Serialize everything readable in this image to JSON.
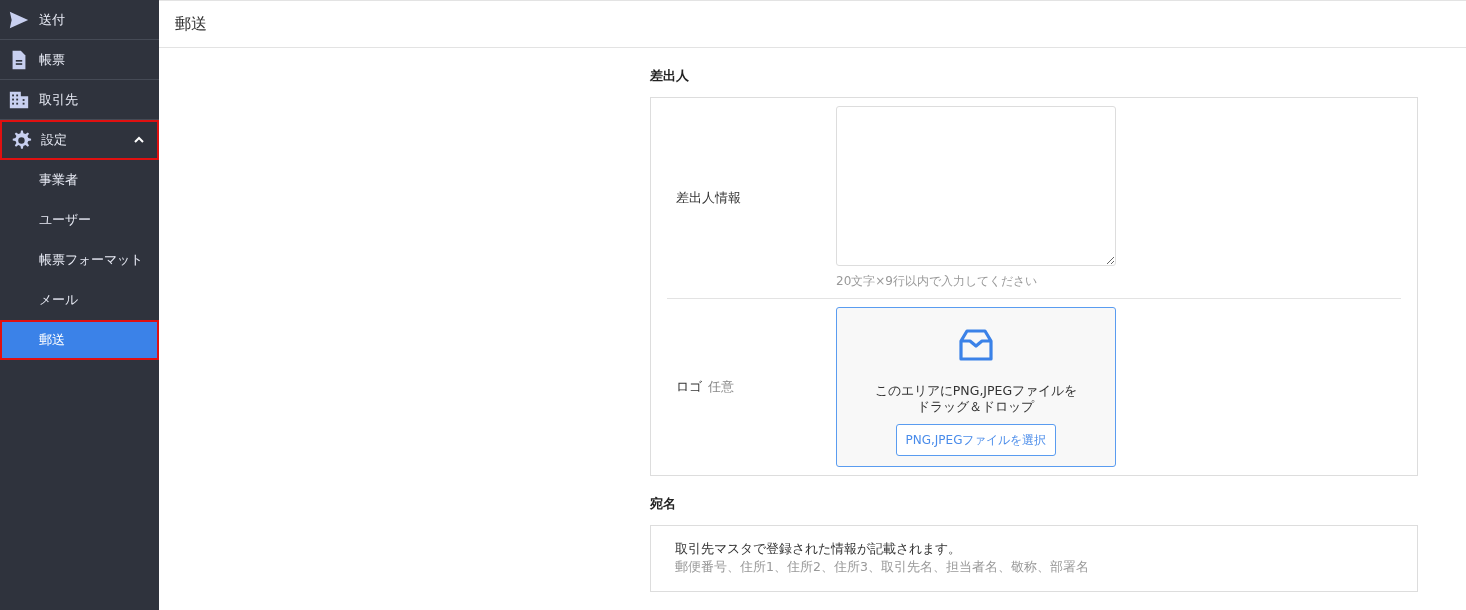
{
  "sidebar": {
    "items": [
      {
        "kind": "link",
        "label": "送付",
        "selected": false,
        "highlighted": false
      },
      {
        "kind": "link",
        "label": "帳票",
        "selected": false,
        "highlighted": false
      },
      {
        "kind": "link",
        "label": "取引先",
        "selected": false,
        "highlighted": false
      },
      {
        "kind": "group",
        "label": "設定",
        "expanded": true,
        "selected": false,
        "highlighted": true,
        "children": [
          {
            "label": "事業者",
            "selected": false,
            "highlighted": false
          },
          {
            "label": "ユーザー",
            "selected": false,
            "highlighted": false
          },
          {
            "label": "帳票フォーマット",
            "selected": false,
            "highlighted": false
          },
          {
            "label": "メール",
            "selected": false,
            "highlighted": false
          },
          {
            "label": "郵送",
            "selected": true,
            "highlighted": true
          }
        ]
      }
    ]
  },
  "page": {
    "title": "郵送"
  },
  "sections": [
    {
      "kind": "form",
      "title": "差出人",
      "rows": [
        {
          "kind": "textarea",
          "label": "差出人情報",
          "hint": "20文字×9行以内で入力してください"
        },
        {
          "kind": "dropzone",
          "label": "ロゴ",
          "optional": "任意",
          "lines": [
            "このエリアにPNG,JPEGファイルを",
            "ドラッグ＆ドロップ"
          ],
          "button": "PNG,JPEGファイルを選択"
        }
      ]
    },
    {
      "kind": "note",
      "title": "宛名",
      "text": "取引先マスタで登録された情報が記載されます。",
      "subtext": "郵便番号、住所1、住所2、住所3、取引先名、担当者名、敬称、部署名"
    }
  ]
}
